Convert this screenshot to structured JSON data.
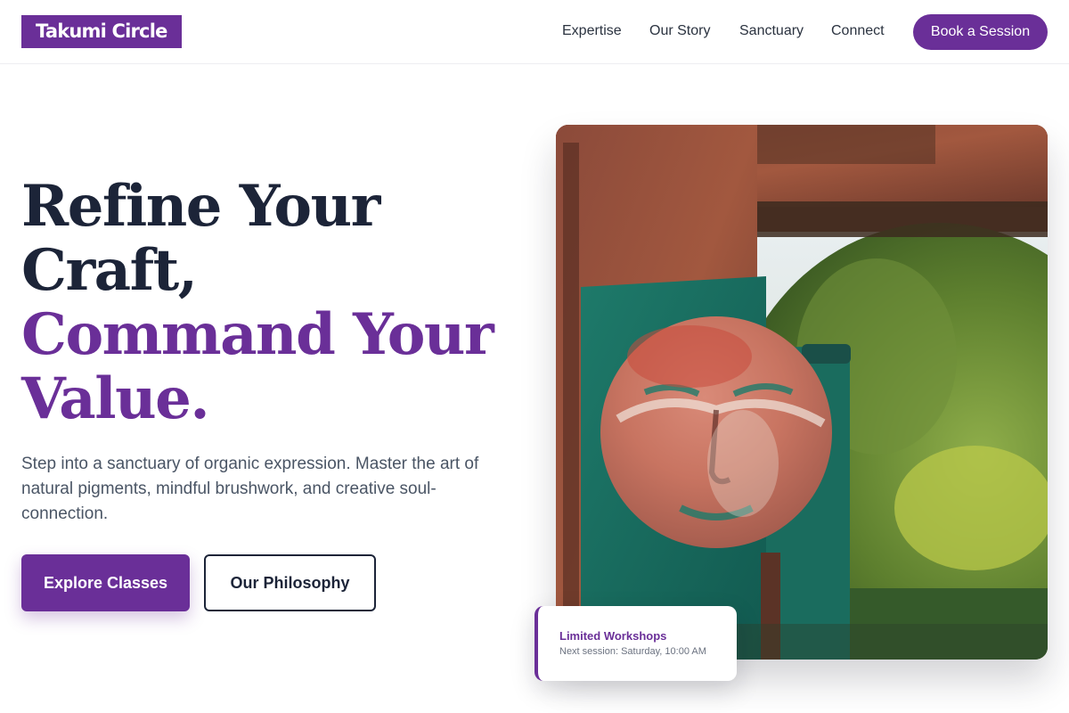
{
  "brand": {
    "logo_text": "Takumi Circle"
  },
  "nav": {
    "items": [
      {
        "label": "Expertise"
      },
      {
        "label": "Our Story"
      },
      {
        "label": "Sanctuary"
      },
      {
        "label": "Connect"
      }
    ],
    "cta_label": "Book a Session"
  },
  "hero": {
    "headline_line1": "Refine Your",
    "headline_line2": "Craft,",
    "headline_line3": "Command Your",
    "headline_line4": "Value.",
    "subtext": "Step into a sanctuary of organic expression. Master the art of natural pigments, mindful brushwork, and creative soul-connection.",
    "primary_button": "Explore Classes",
    "secondary_button": "Our Philosophy"
  },
  "workshop_card": {
    "title": "Limited Workshops",
    "subtitle": "Next session: Saturday, 10:00 AM"
  },
  "colors": {
    "accent": "#6a2f98",
    "heading": "#1c2438",
    "body_text": "#4a5565"
  },
  "icons": {
    "hero_image": "painted-face-artwork"
  }
}
